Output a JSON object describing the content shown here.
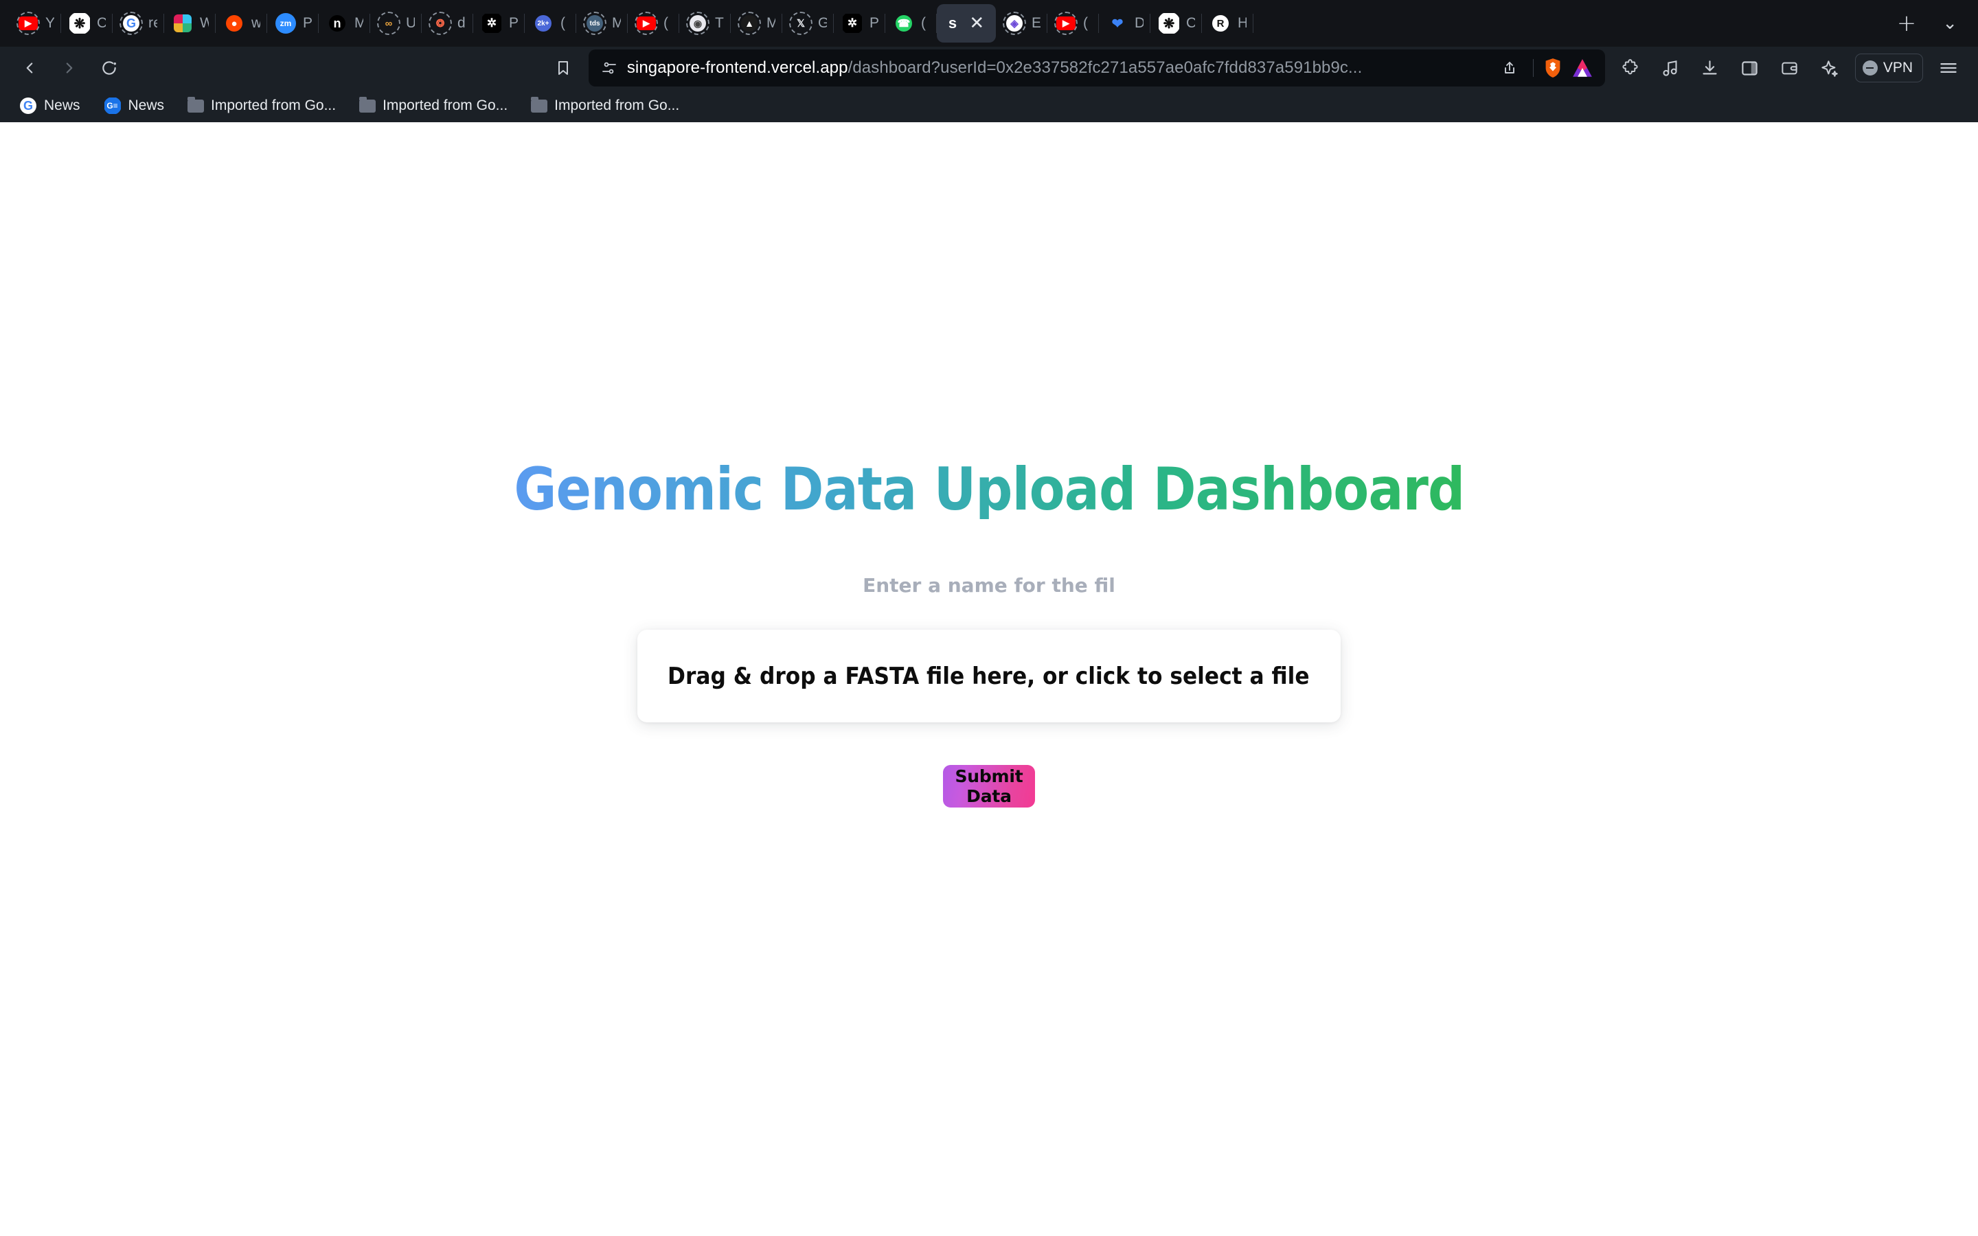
{
  "browser": {
    "nav": {
      "back_icon": "chevron-left-icon",
      "forward_icon": "chevron-right-icon",
      "reload_icon": "reload-icon",
      "bookmark_icon": "bookmark-icon"
    },
    "url": {
      "site_settings_icon": "site-settings-icon",
      "host": "singapore-frontend.vercel.app",
      "path": "/dashboard?userId=0x2e337582fc271a557ae0afc7fdd837a591bb9c...",
      "share_icon": "share-icon",
      "brave_shields_icon": "brave-shields-icon",
      "brave_rewards_icon": "brave-rewards-icon"
    },
    "toolbar": {
      "extensions_icon": "puzzle-icon",
      "music_icon": "music-note-icon",
      "downloads_icon": "download-icon",
      "sidebar_icon": "sidebar-panel-icon",
      "wallet_icon": "wallet-icon",
      "leo_ai_icon": "sparkle-icon",
      "vpn_label": "VPN",
      "vpn_status_icon": "minus-circle-icon",
      "menu_icon": "hamburger-menu-icon"
    },
    "tabstrip": {
      "new_tab_icon": "plus-icon",
      "tab_list_icon": "chevron-down-icon",
      "close_icon": "close-icon",
      "tabs": [
        {
          "favicon": "youtube-icon",
          "title": "Y",
          "active": false
        },
        {
          "favicon": "chatgpt-icon",
          "title": "C",
          "active": false
        },
        {
          "favicon": "google-icon",
          "title": "re",
          "active": false
        },
        {
          "favicon": "slack-icon",
          "title": "W",
          "active": false
        },
        {
          "favicon": "reddit-icon",
          "title": "w",
          "active": false
        },
        {
          "favicon": "zoom-icon",
          "title": "P",
          "active": false
        },
        {
          "favicon": "notion-icon",
          "title": "M",
          "active": false
        },
        {
          "favicon": "colab-icon",
          "title": "U",
          "active": false
        },
        {
          "favicon": "dbt-icon",
          "title": "d",
          "active": false
        },
        {
          "favicon": "perplexity-icon",
          "title": "P",
          "active": false
        },
        {
          "favicon": "notifications-icon",
          "title": "(",
          "active": false,
          "badge": "2k+"
        },
        {
          "favicon": "tds-icon",
          "title": "M",
          "active": false
        },
        {
          "favicon": "youtube-icon",
          "title": "(",
          "active": false
        },
        {
          "favicon": "globe-icon",
          "title": "T",
          "active": false
        },
        {
          "favicon": "medium-icon",
          "title": "M",
          "active": false
        },
        {
          "favicon": "x-icon",
          "title": "G",
          "active": false
        },
        {
          "favicon": "perplexity-icon",
          "title": "P",
          "active": false
        },
        {
          "favicon": "whatsapp-icon",
          "title": "(",
          "active": false
        },
        {
          "favicon": "none",
          "title": "s",
          "active": true
        },
        {
          "favicon": "ethereum-icon",
          "title": "E",
          "active": false
        },
        {
          "favicon": "youtube-icon",
          "title": "(",
          "active": false
        },
        {
          "favicon": "bluesky-icon",
          "title": "D",
          "active": false
        },
        {
          "favicon": "chatgpt-icon",
          "title": "C",
          "active": false
        },
        {
          "favicon": "researchgate-icon",
          "title": "H",
          "active": false
        }
      ]
    },
    "bookmarks": [
      {
        "icon": "google-icon",
        "label": "News"
      },
      {
        "icon": "google-news-icon",
        "label": "News"
      },
      {
        "icon": "folder-icon",
        "label": "Imported from Go..."
      },
      {
        "icon": "folder-icon",
        "label": "Imported from Go..."
      },
      {
        "icon": "folder-icon",
        "label": "Imported from Go..."
      }
    ]
  },
  "page": {
    "title": "Genomic Data Upload Dashboard",
    "name_input": {
      "placeholder": "Enter a name for the fil",
      "value": ""
    },
    "dropzone_text": "Drag & drop a FASTA file here, or click to select a file",
    "submit_label": "Submit Data",
    "colors": {
      "title_gradient_start": "#5b9bf0",
      "title_gradient_end": "#2eb95e",
      "submit_gradient_start": "#b45ae6",
      "submit_gradient_end": "#f33a93",
      "placeholder": "#a8aeba",
      "page_background": "#ffffff"
    }
  }
}
